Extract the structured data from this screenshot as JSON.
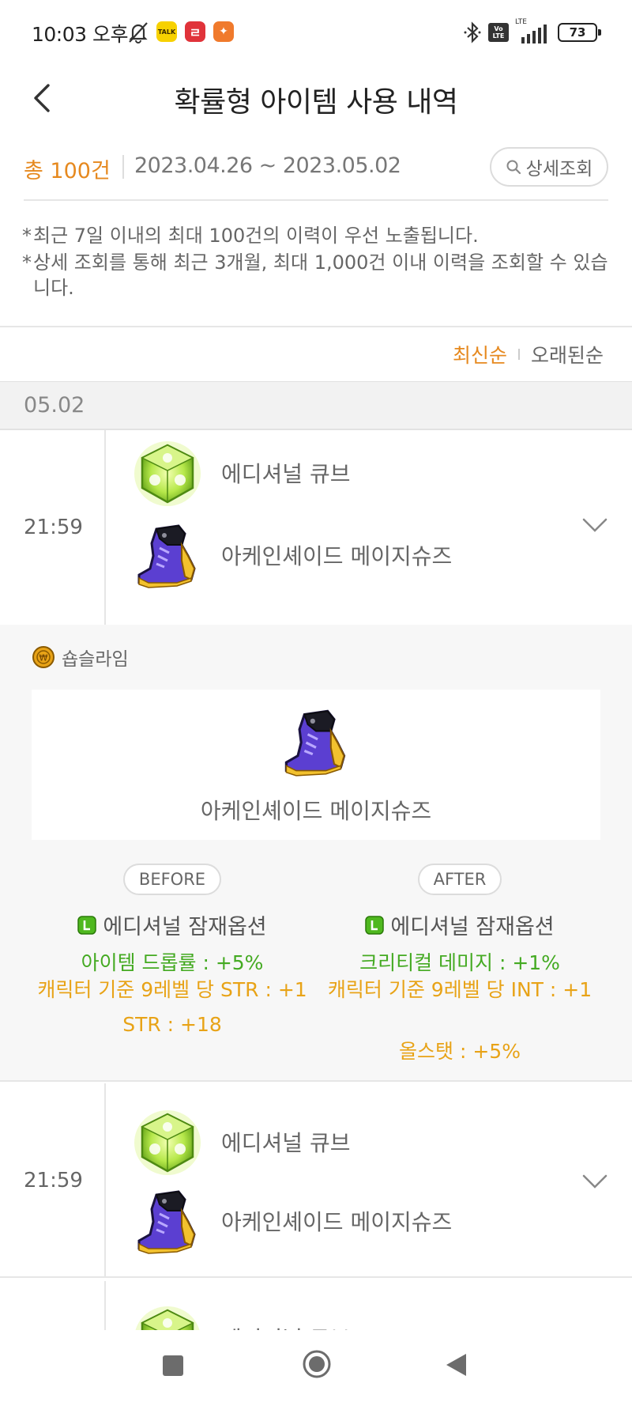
{
  "status_bar": {
    "time": "10:03 오후",
    "kakao_badge": "TALK",
    "battery": "73",
    "network": "LTE",
    "volte_top": "Vo",
    "volte_bottom": "LTE"
  },
  "header": {
    "title": "확률형 아이템 사용 내역"
  },
  "summary": {
    "total": "총 100건",
    "date_range": "2023.04.26 ~ 2023.05.02",
    "detail_button": "상세조회"
  },
  "notices": [
    "최근 7일 이내의 최대 100건의 이력이 우선 노출됩니다.",
    "상세 조회를 통해 최근 3개월, 최대 1,000건 이내 이력을 조회할 수 있습니다."
  ],
  "sort": {
    "latest": "최신순",
    "oldest": "오래된순",
    "active": "latest"
  },
  "date_group": "05.02",
  "records": [
    {
      "time": "21:59",
      "cube": "에디셔널 큐브",
      "item": "아케인셰이드 메이지슈즈",
      "cube_icon": "additional-cube-icon",
      "item_icon": "mage-shoes-icon",
      "expanded": true
    },
    {
      "time": "21:59",
      "cube": "에디셔널 큐브",
      "item": "아케인셰이드 메이지슈즈",
      "cube_icon": "additional-cube-icon",
      "item_icon": "mage-shoes-icon",
      "expanded": false
    },
    {
      "time": "",
      "cube": "에디셔널 큐브",
      "item": "",
      "cube_icon": "additional-cube-icon",
      "expanded": false
    }
  ],
  "detail": {
    "character": "숍슬라임",
    "item_name": "아케인셰이드 메이지슈즈",
    "before": {
      "label": "BEFORE",
      "potential": "에디셔널 잠재옵션",
      "options": [
        "아이템 드롭률 : +5%",
        "캐릭터 기준 9레벨 당 STR : +1",
        "STR : +18"
      ]
    },
    "after": {
      "label": "AFTER",
      "potential": "에디셔널 잠재옵션",
      "options": [
        "크리티컬 데미지 : +1%",
        "캐릭터 기준 9레벨 당 INT : +1",
        "올스탯 : +5%"
      ]
    }
  },
  "colors": {
    "accent_orange": "#e6891f",
    "option_green": "#44aa22",
    "option_gold": "#e8a317"
  }
}
